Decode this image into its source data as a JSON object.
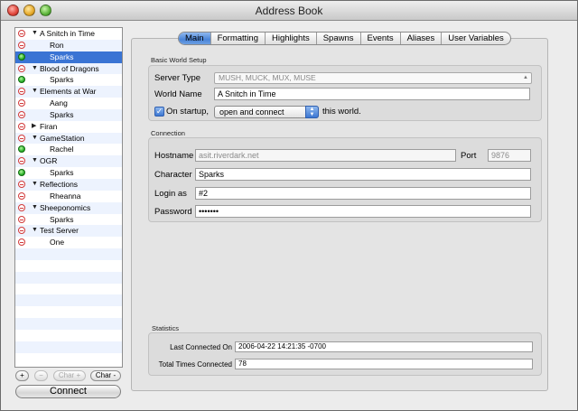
{
  "window": {
    "title": "Address Book"
  },
  "worlds": [
    {
      "name": "A Snitch in Time",
      "status": "off",
      "chars": [
        {
          "name": "Ron",
          "status": "off"
        },
        {
          "name": "Sparks",
          "status": "on",
          "selected": true
        }
      ]
    },
    {
      "name": "Blood of Dragons",
      "status": "off",
      "chars": [
        {
          "name": "Sparks",
          "status": "on"
        }
      ]
    },
    {
      "name": "Elements at War",
      "status": "off",
      "chars": [
        {
          "name": "Aang",
          "status": "off"
        },
        {
          "name": "Sparks",
          "status": "off"
        }
      ]
    },
    {
      "name": "Firan",
      "status": "off",
      "collapsed": true,
      "chars": []
    },
    {
      "name": "GameStation",
      "status": "off",
      "chars": [
        {
          "name": "Rachel",
          "status": "on"
        }
      ]
    },
    {
      "name": "OGR",
      "status": "off",
      "chars": [
        {
          "name": "Sparks",
          "status": "on"
        }
      ]
    },
    {
      "name": "Reflections",
      "status": "off",
      "chars": [
        {
          "name": "Rheanna",
          "status": "off"
        }
      ]
    },
    {
      "name": "Sheeponomics",
      "status": "off",
      "chars": [
        {
          "name": "Sparks",
          "status": "off"
        }
      ]
    },
    {
      "name": "Test Server",
      "status": "off",
      "chars": [
        {
          "name": "One",
          "status": "off"
        }
      ]
    }
  ],
  "list_buttons": {
    "add": "+",
    "remove": "−",
    "char_add": "Char +",
    "char_remove": "Char -",
    "connect": "Connect"
  },
  "tabs": [
    "Main",
    "Formatting",
    "Highlights",
    "Spawns",
    "Events",
    "Aliases",
    "User Variables"
  ],
  "active_tab": "Main",
  "basic": {
    "section_title": "Basic World Setup",
    "server_type_label": "Server Type",
    "server_type_value": "MUSH, MUCK, MUX, MUSE",
    "world_name_label": "World Name",
    "world_name_value": "A Snitch in Time",
    "startup_label": "On startup,",
    "startup_value": "open and connect",
    "startup_suffix": "this world."
  },
  "connection": {
    "section_title": "Connection",
    "hostname_label": "Hostname",
    "hostname_value": "asit.riverdark.net",
    "port_label": "Port",
    "port_value": "9876",
    "character_label": "Character",
    "character_value": "Sparks",
    "login_label": "Login as",
    "login_value": "#2",
    "password_label": "Password",
    "password_value": "•••••••"
  },
  "statistics": {
    "section_title": "Statistics",
    "last_connected_label": "Last Connected On",
    "last_connected_value": "2006-04-22 14:21:35 -0700",
    "total_times_label": "Total Times Connected",
    "total_times_value": "78"
  }
}
